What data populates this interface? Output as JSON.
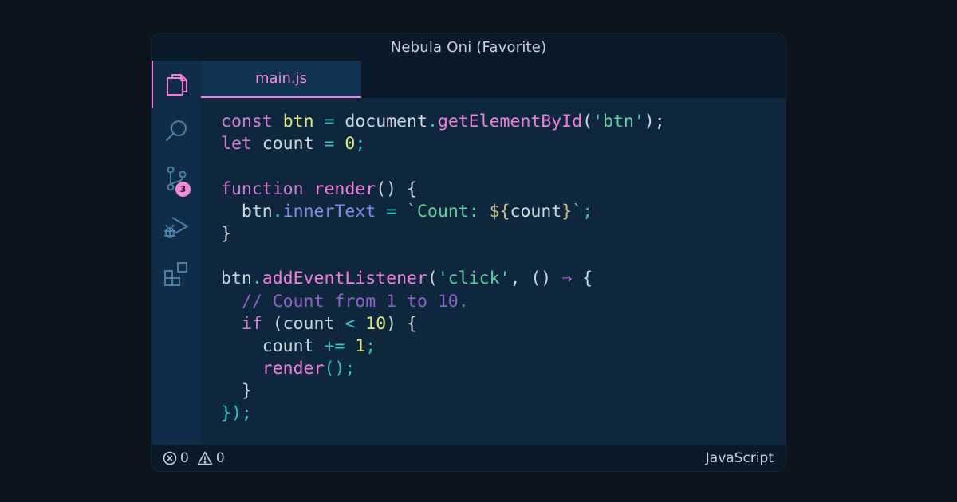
{
  "window": {
    "title": "Nebula Oni (Favorite)"
  },
  "activity_bar": {
    "items": [
      {
        "icon": "files-icon",
        "active": true
      },
      {
        "icon": "search-icon"
      },
      {
        "icon": "source-control-icon",
        "badge": "3"
      },
      {
        "icon": "run-debug-icon"
      },
      {
        "icon": "extensions-icon"
      }
    ]
  },
  "tabs": [
    {
      "label": "main.js",
      "active": true
    }
  ],
  "code": {
    "lines": [
      [
        {
          "t": "const",
          "c": "kw"
        },
        {
          "t": " ",
          "c": "plain"
        },
        {
          "t": "btn",
          "c": "var"
        },
        {
          "t": " ",
          "c": "plain"
        },
        {
          "t": "=",
          "c": "op"
        },
        {
          "t": " document",
          "c": "plain"
        },
        {
          "t": ".",
          "c": "op"
        },
        {
          "t": "getElementById",
          "c": "fn"
        },
        {
          "t": "(",
          "c": "plain"
        },
        {
          "t": "'btn'",
          "c": "str"
        },
        {
          "t": ");",
          "c": "plain"
        }
      ],
      [
        {
          "t": "let",
          "c": "kw"
        },
        {
          "t": " count ",
          "c": "plain"
        },
        {
          "t": "=",
          "c": "op"
        },
        {
          "t": " ",
          "c": "plain"
        },
        {
          "t": "0",
          "c": "num"
        },
        {
          "t": ";",
          "c": "op"
        }
      ],
      [],
      [
        {
          "t": "function",
          "c": "kw"
        },
        {
          "t": " ",
          "c": "plain"
        },
        {
          "t": "render",
          "c": "fn"
        },
        {
          "t": "() {",
          "c": "plain"
        }
      ],
      [
        {
          "t": "  btn",
          "c": "plain"
        },
        {
          "t": ".",
          "c": "op"
        },
        {
          "t": "innerText",
          "c": "prop"
        },
        {
          "t": " ",
          "c": "plain"
        },
        {
          "t": "=",
          "c": "op"
        },
        {
          "t": " ",
          "c": "plain"
        },
        {
          "t": "`Count: ",
          "c": "str"
        },
        {
          "t": "${",
          "c": "brace"
        },
        {
          "t": "count",
          "c": "plain"
        },
        {
          "t": "}",
          "c": "brace"
        },
        {
          "t": "`",
          "c": "str"
        },
        {
          "t": ";",
          "c": "op"
        }
      ],
      [
        {
          "t": "}",
          "c": "plain"
        }
      ],
      [],
      [
        {
          "t": "btn",
          "c": "plain"
        },
        {
          "t": ".",
          "c": "op"
        },
        {
          "t": "addEventListener",
          "c": "fn"
        },
        {
          "t": "(",
          "c": "plain"
        },
        {
          "t": "'click'",
          "c": "str"
        },
        {
          "t": ", () ",
          "c": "plain"
        },
        {
          "t": "⇒",
          "c": "arrow"
        },
        {
          "t": " {",
          "c": "plain"
        }
      ],
      [
        {
          "t": "  ",
          "c": "plain"
        },
        {
          "t": "// Count from 1 to 10.",
          "c": "cm"
        }
      ],
      [
        {
          "t": "  ",
          "c": "plain"
        },
        {
          "t": "if",
          "c": "kw"
        },
        {
          "t": " (count ",
          "c": "plain"
        },
        {
          "t": "<",
          "c": "op"
        },
        {
          "t": " ",
          "c": "plain"
        },
        {
          "t": "10",
          "c": "num"
        },
        {
          "t": ") {",
          "c": "plain"
        }
      ],
      [
        {
          "t": "    count ",
          "c": "plain"
        },
        {
          "t": "+=",
          "c": "op"
        },
        {
          "t": " ",
          "c": "plain"
        },
        {
          "t": "1",
          "c": "num"
        },
        {
          "t": ";",
          "c": "op"
        }
      ],
      [
        {
          "t": "    ",
          "c": "plain"
        },
        {
          "t": "render",
          "c": "fn"
        },
        {
          "t": "();",
          "c": "op"
        }
      ],
      [
        {
          "t": "  }",
          "c": "plain"
        }
      ],
      [
        {
          "t": "});",
          "c": "op"
        }
      ]
    ]
  },
  "status": {
    "errors": "0",
    "warnings": "0",
    "language": "JavaScript"
  },
  "colors": {
    "accent": "#f17eda",
    "background": "#0c141d",
    "editor": "#0f273d",
    "activity_bar": "#102c48"
  }
}
